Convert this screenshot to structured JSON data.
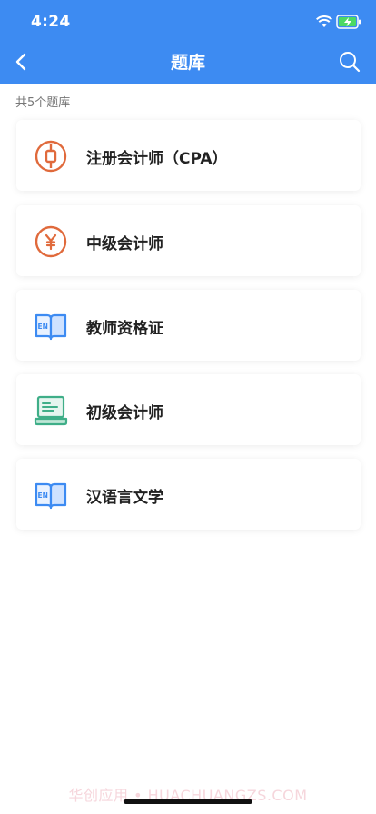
{
  "status_bar": {
    "time": "4:24"
  },
  "header": {
    "title": "题库"
  },
  "summary": {
    "count_text": "共5个题库"
  },
  "items": [
    {
      "label": "注册会计师（CPA）",
      "icon": "coin-icon",
      "color": "#e06a3c"
    },
    {
      "label": "中级会计师",
      "icon": "yuan-icon",
      "color": "#e06a3c"
    },
    {
      "label": "教师资格证",
      "icon": "en-book-icon",
      "color": "#3d8bf2"
    },
    {
      "label": "初级会计师",
      "icon": "laptop-icon",
      "color": "#3fae88"
    },
    {
      "label": "汉语言文学",
      "icon": "en-book-icon",
      "color": "#3d8bf2"
    }
  ],
  "watermark": "华创应用 • HUACHUANGZS.COM",
  "colors": {
    "header_bg": "#3d8bf2",
    "orange": "#e06a3c",
    "blue": "#3d8bf2",
    "green": "#3fae88"
  }
}
